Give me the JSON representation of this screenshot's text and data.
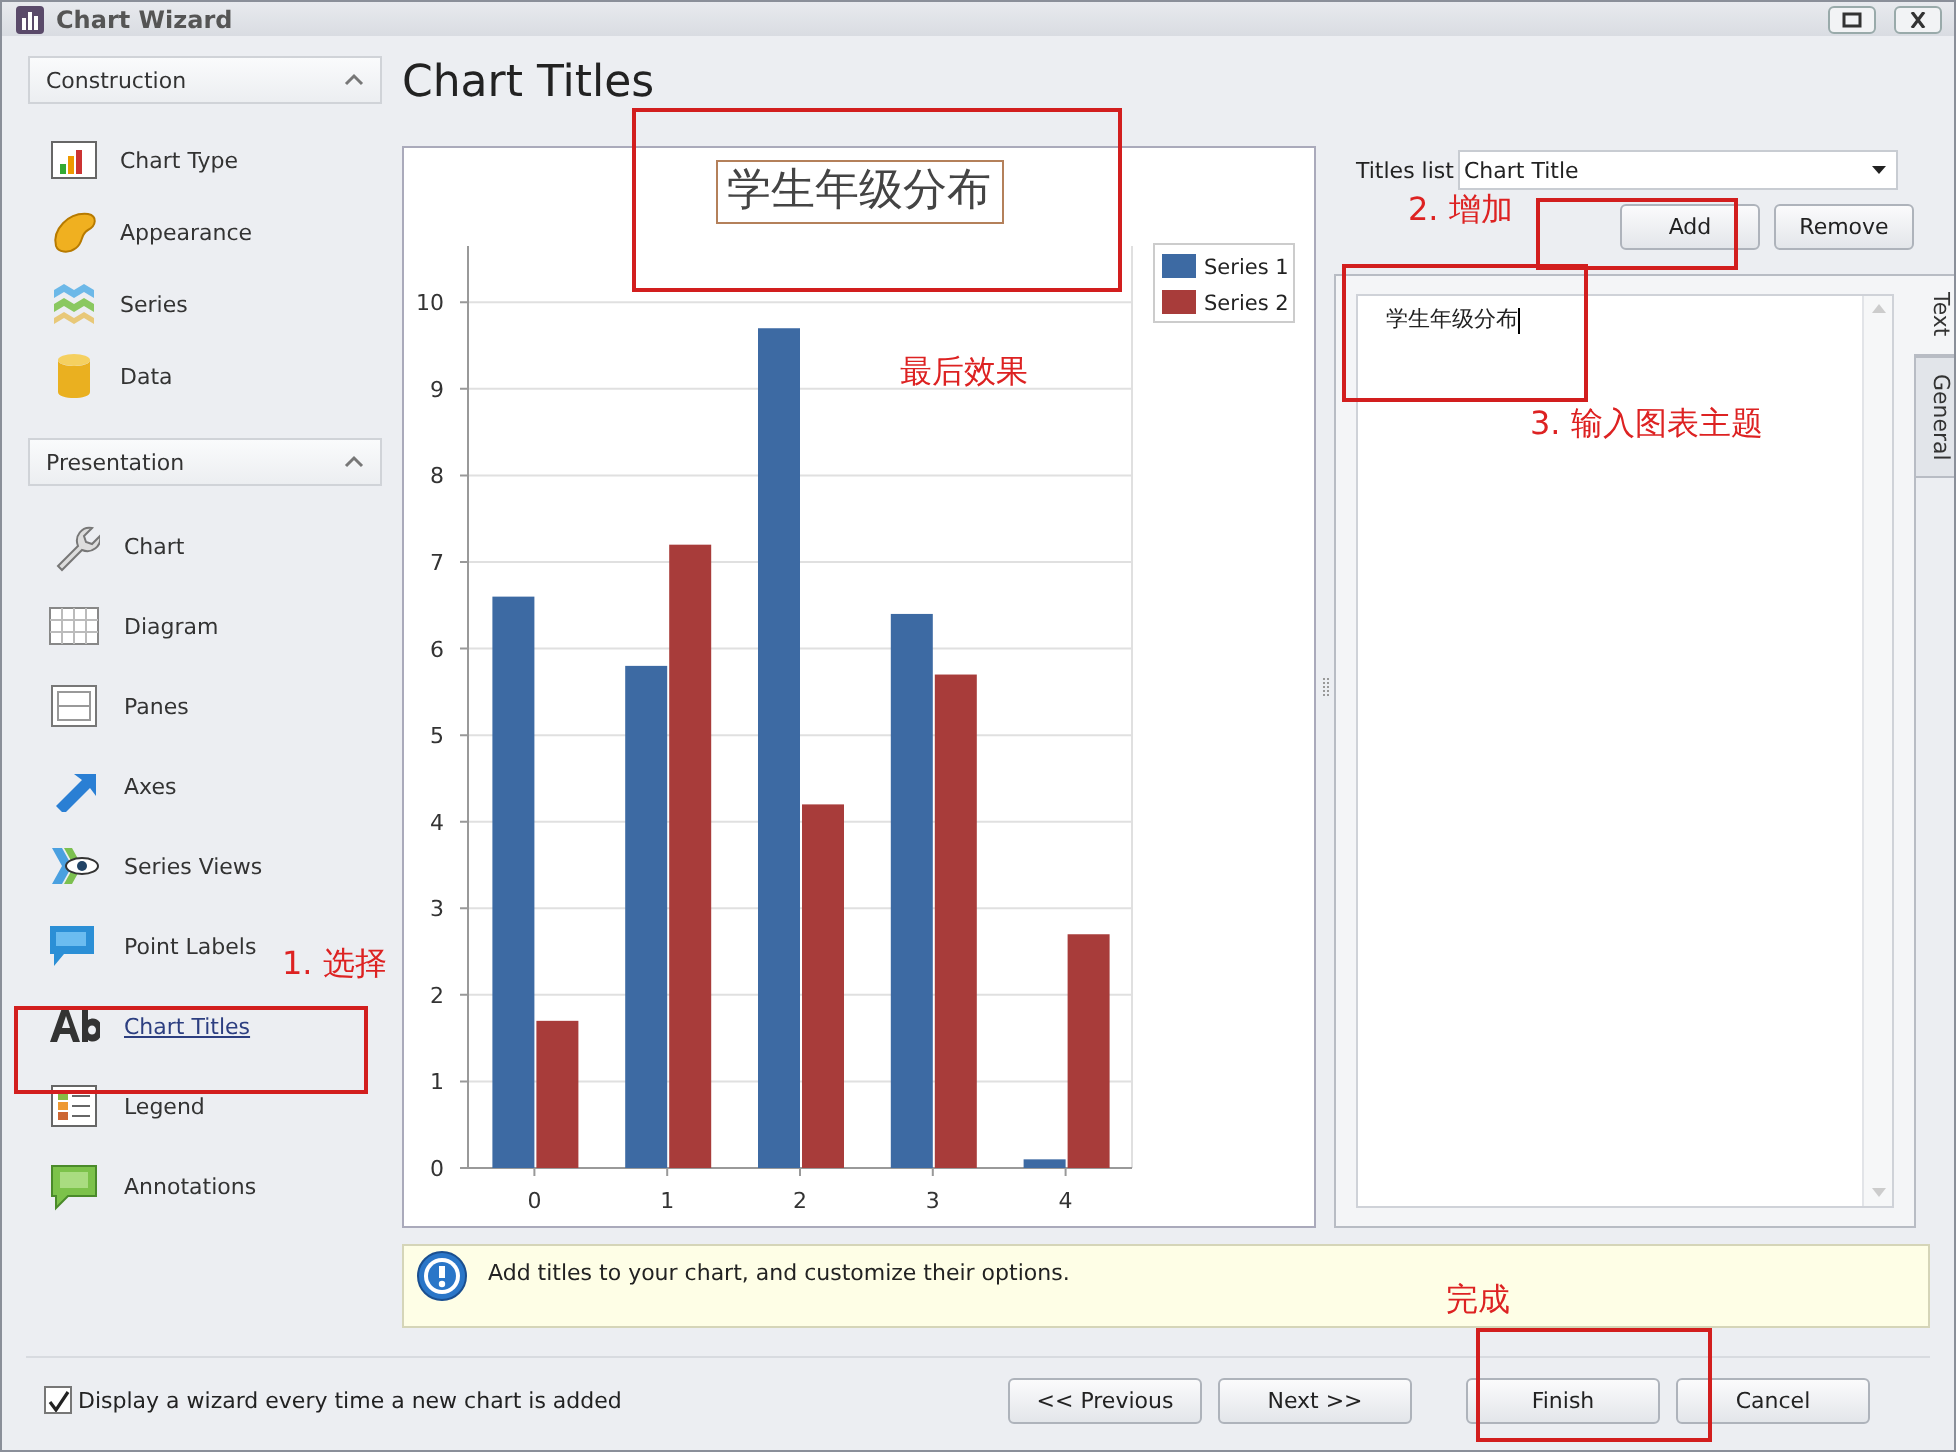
{
  "window": {
    "title": "Chart Wizard"
  },
  "sidebar": {
    "groups": [
      {
        "title": "Construction",
        "expanded": true,
        "items": [
          {
            "label": "Chart Type",
            "selected": false
          },
          {
            "label": "Appearance",
            "selected": false
          },
          {
            "label": "Series",
            "selected": false
          },
          {
            "label": "Data",
            "selected": false
          }
        ]
      },
      {
        "title": "Presentation",
        "expanded": true,
        "items": [
          {
            "label": "Chart",
            "selected": false
          },
          {
            "label": "Diagram",
            "selected": false
          },
          {
            "label": "Panes",
            "selected": false
          },
          {
            "label": "Axes",
            "selected": false
          },
          {
            "label": "Series Views",
            "selected": false
          },
          {
            "label": "Point Labels",
            "selected": false
          },
          {
            "label": "Chart Titles",
            "selected": true
          },
          {
            "label": "Legend",
            "selected": false
          },
          {
            "label": "Annotations",
            "selected": false
          }
        ]
      }
    ]
  },
  "page": {
    "heading": "Chart Titles"
  },
  "chart": {
    "title": "学生年级分布",
    "chart_data": {
      "type": "bar",
      "categories": [
        "0",
        "1",
        "2",
        "3",
        "4"
      ],
      "series": [
        {
          "name": "Series 1",
          "color": "#3d6aa3",
          "values": [
            6.6,
            5.8,
            9.7,
            6.4,
            0.1
          ]
        },
        {
          "name": "Series 2",
          "color": "#a83c3a",
          "values": [
            1.7,
            7.2,
            4.2,
            5.7,
            2.7
          ]
        }
      ],
      "ylim": [
        0,
        10.65
      ],
      "yticks": [
        0,
        1,
        2,
        3,
        4,
        5,
        6,
        7,
        8,
        9,
        10
      ],
      "grid": true,
      "legend": true
    }
  },
  "titles_panel": {
    "label": "Titles list",
    "combo_value": "Chart Title",
    "buttons": [
      "Add",
      "Remove"
    ],
    "tabs": [
      {
        "label": "Text",
        "selected": true
      },
      {
        "label": "General",
        "selected": false
      }
    ],
    "text_value": "学生年级分布"
  },
  "info": {
    "text": "Add titles to your chart, and customize their options."
  },
  "footer": {
    "checkbox": {
      "label": "Display a wizard every time a new chart is added",
      "checked": true
    },
    "buttons": [
      "<< Previous",
      "Next >>",
      "Finish",
      "Cancel"
    ]
  },
  "annotations": [
    {
      "text": "1. 选择"
    },
    {
      "text": "2. 增加"
    },
    {
      "text": "3. 输入图表主题"
    },
    {
      "text": "最后效果"
    },
    {
      "text": "完成"
    }
  ]
}
